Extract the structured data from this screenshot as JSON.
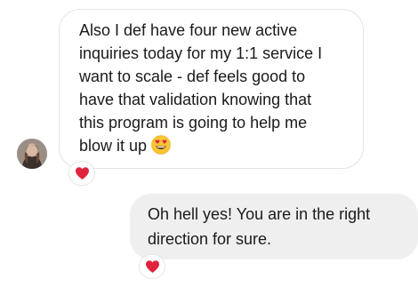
{
  "conversation": {
    "incoming": {
      "lines": [
        "Also I def have four new active",
        "inquiries today for my 1:1 service I",
        "want to scale - def feels good to",
        "have that validation knowing that",
        "this program is going to help me",
        "blow it up"
      ],
      "emoji": "smiling-face-with-heart-eyes",
      "reaction": "red-heart"
    },
    "outgoing": {
      "lines": [
        "Oh hell yes! You are in the right",
        "direction for sure."
      ],
      "reaction": "red-heart"
    }
  },
  "colors": {
    "outgoing_bubble": "#efefef",
    "incoming_border": "#e3e3e3",
    "text": "#1a1a1a",
    "heart": "#e0243d"
  }
}
